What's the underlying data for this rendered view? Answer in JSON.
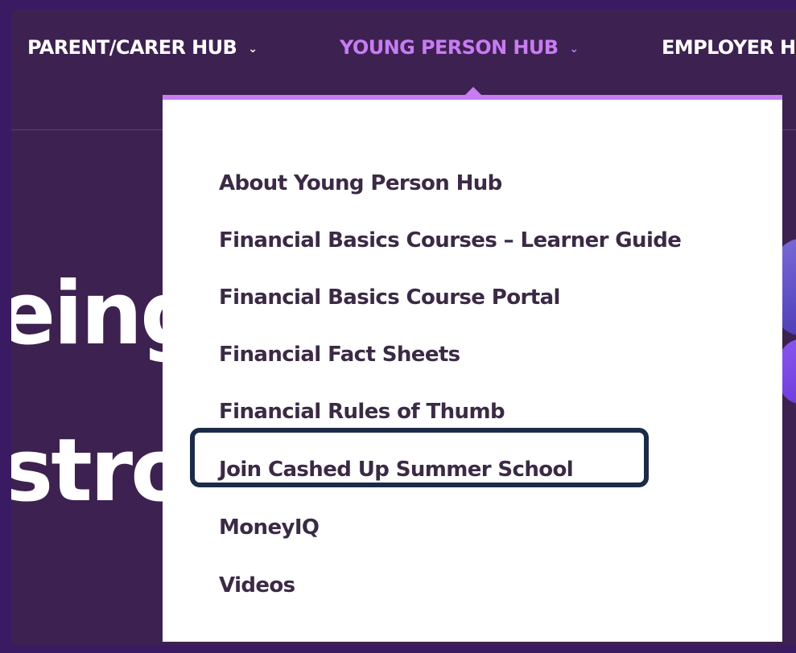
{
  "nav": {
    "items": [
      {
        "label": "PARENT/CARER HUB",
        "chevron": "⌄"
      },
      {
        "label": "YOUNG PERSON HUB",
        "chevron": "⌄"
      },
      {
        "label": "EMPLOYER H"
      }
    ]
  },
  "hero": {
    "line1": "eing",
    "line2": "stro"
  },
  "dropdown": {
    "items": [
      "About Young Person Hub",
      "Financial Basics Courses – Learner Guide",
      "Financial Basics Course Portal",
      "Financial Fact Sheets",
      "Financial Rules of Thumb",
      "Join Cashed Up Summer School",
      "MoneyIQ",
      "Videos"
    ]
  },
  "colors": {
    "background": "#3a1a63",
    "page": "#3d2150",
    "active_nav": "#c77cf2",
    "menu_text": "#3b2a45",
    "highlight": "#1c2b48"
  }
}
